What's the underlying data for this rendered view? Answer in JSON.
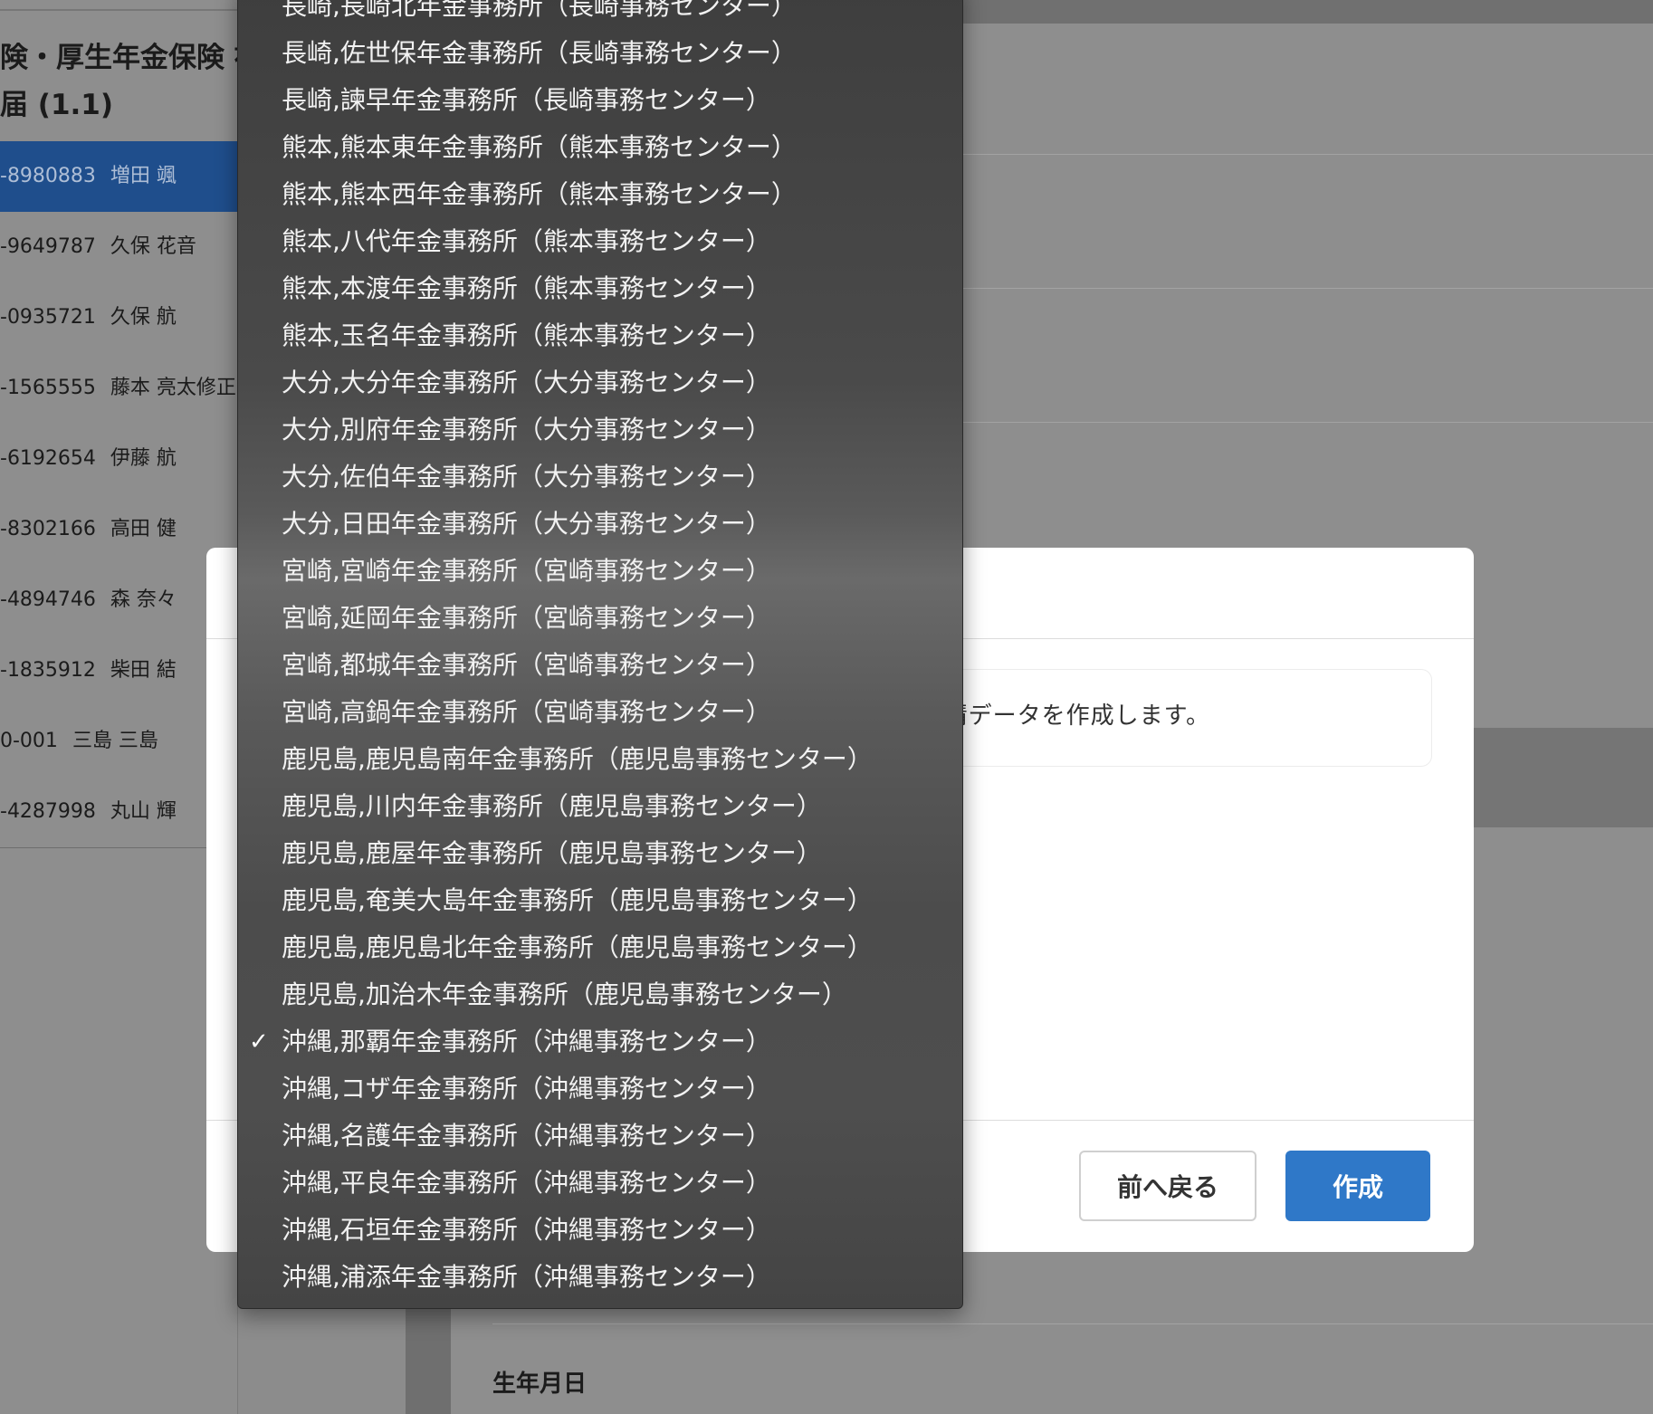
{
  "left_panel": {
    "title_line1": "険・厚生年金保険 被",
    "title_line2": "届 (1.1)",
    "employees": [
      {
        "num": "-8980883",
        "name": "増田 颯",
        "selected": true
      },
      {
        "num": "-9649787",
        "name": "久保 花音",
        "selected": false
      },
      {
        "num": "-0935721",
        "name": "久保 航",
        "selected": false
      },
      {
        "num": "-1565555",
        "name": "藤本 亮太修正",
        "selected": false
      },
      {
        "num": "-6192654",
        "name": "伊藤 航",
        "selected": false
      },
      {
        "num": "-8302166",
        "name": "高田 健",
        "selected": false
      },
      {
        "num": "-4894746",
        "name": "森 奈々",
        "selected": false
      },
      {
        "num": "-1835912",
        "name": "柴田 結",
        "selected": false
      },
      {
        "num": "0-001",
        "name": "三島 三島",
        "selected": false
      },
      {
        "num": "-4287998",
        "name": "丸山 輝",
        "selected": false
      }
    ]
  },
  "main": {
    "field_label_birthdate": "生年月日"
  },
  "modal": {
    "info_text": "請データを作成します。",
    "back_label": "前へ戻る",
    "create_label": "作成"
  },
  "dropdown": {
    "selected_index": 22,
    "check_glyph": "✓",
    "options": [
      "長崎,長崎北年金事務所（長崎事務センター）",
      "長崎,佐世保年金事務所（長崎事務センター）",
      "長崎,諫早年金事務所（長崎事務センター）",
      "熊本,熊本東年金事務所（熊本事務センター）",
      "熊本,熊本西年金事務所（熊本事務センター）",
      "熊本,八代年金事務所（熊本事務センター）",
      "熊本,本渡年金事務所（熊本事務センター）",
      "熊本,玉名年金事務所（熊本事務センター）",
      "大分,大分年金事務所（大分事務センター）",
      "大分,別府年金事務所（大分事務センター）",
      "大分,佐伯年金事務所（大分事務センター）",
      "大分,日田年金事務所（大分事務センター）",
      "宮崎,宮崎年金事務所（宮崎事務センター）",
      "宮崎,延岡年金事務所（宮崎事務センター）",
      "宮崎,都城年金事務所（宮崎事務センター）",
      "宮崎,高鍋年金事務所（宮崎事務センター）",
      "鹿児島,鹿児島南年金事務所（鹿児島事務センター）",
      "鹿児島,川内年金事務所（鹿児島事務センター）",
      "鹿児島,鹿屋年金事務所（鹿児島事務センター）",
      "鹿児島,奄美大島年金事務所（鹿児島事務センター）",
      "鹿児島,鹿児島北年金事務所（鹿児島事務センター）",
      "鹿児島,加治木年金事務所（鹿児島事務センター）",
      "沖縄,那覇年金事務所（沖縄事務センター）",
      "沖縄,コザ年金事務所（沖縄事務センター）",
      "沖縄,名護年金事務所（沖縄事務センター）",
      "沖縄,平良年金事務所（沖縄事務センター）",
      "沖縄,石垣年金事務所（沖縄事務センター）",
      "沖縄,浦添年金事務所（沖縄事務センター）"
    ]
  }
}
